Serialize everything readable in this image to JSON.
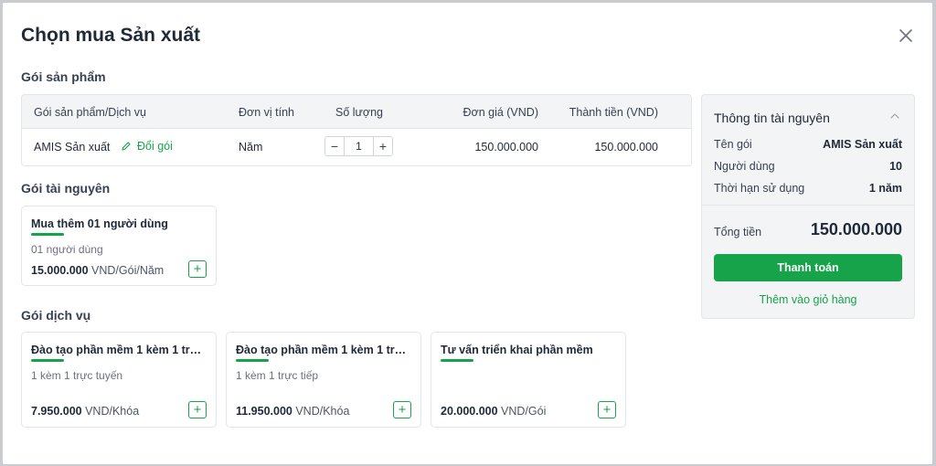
{
  "dialog": {
    "title": "Chọn mua Sản xuất"
  },
  "sections": {
    "product": "Gói sản phẩm",
    "resource": "Gói tài nguyên",
    "service": "Gói dịch vụ"
  },
  "table": {
    "headers": [
      "Gói sản phẩm/Dịch vụ",
      "Đơn vị tính",
      "Số lượng",
      "Đơn giá (VND)",
      "Thành tiền (VND)"
    ],
    "row": {
      "name": "AMIS Sản xuất",
      "change_label": "Đổi gói",
      "unit": "Năm",
      "quantity": "1",
      "unit_price": "150.000.000",
      "amount": "150.000.000"
    }
  },
  "resource_cards": [
    {
      "title": "Mua thêm 01 người dùng",
      "desc": "01 người dùng",
      "price": "15.000.000",
      "unit": " VND/Gói/Năm"
    }
  ],
  "service_cards": [
    {
      "title": "Đào tạo phần mềm 1 kèm 1 trực...",
      "desc": "1 kèm 1 trực tuyến",
      "price": "7.950.000",
      "unit": " VND/Khóa"
    },
    {
      "title": "Đào tạo phần mềm 1 kèm 1 trực...",
      "desc": "1 kèm 1 trực tiếp",
      "price": "11.950.000",
      "unit": " VND/Khóa"
    },
    {
      "title": "Tư vấn triển khai phần mềm",
      "desc": "",
      "price": "20.000.000",
      "unit": " VND/Gói"
    }
  ],
  "summary": {
    "title": "Thông tin tài nguyên",
    "rows": [
      {
        "label": "Tên gói",
        "value": "AMIS Sản xuất"
      },
      {
        "label": "Người dùng",
        "value": "10"
      },
      {
        "label": "Thời hạn sử dụng",
        "value": "1 năm"
      }
    ],
    "total_label": "Tổng tiền",
    "total_value": "150.000.000",
    "pay_label": "Thanh toán",
    "cart_label": "Thêm vào giỏ hàng"
  },
  "icons": {
    "close": "close-icon",
    "edit": "pencil-icon",
    "collapse": "chevron-up-icon",
    "add": "plus-icon"
  },
  "colors": {
    "accent": "#16a34a",
    "text": "#1f2937",
    "panel_bg": "#f3f4f6"
  }
}
